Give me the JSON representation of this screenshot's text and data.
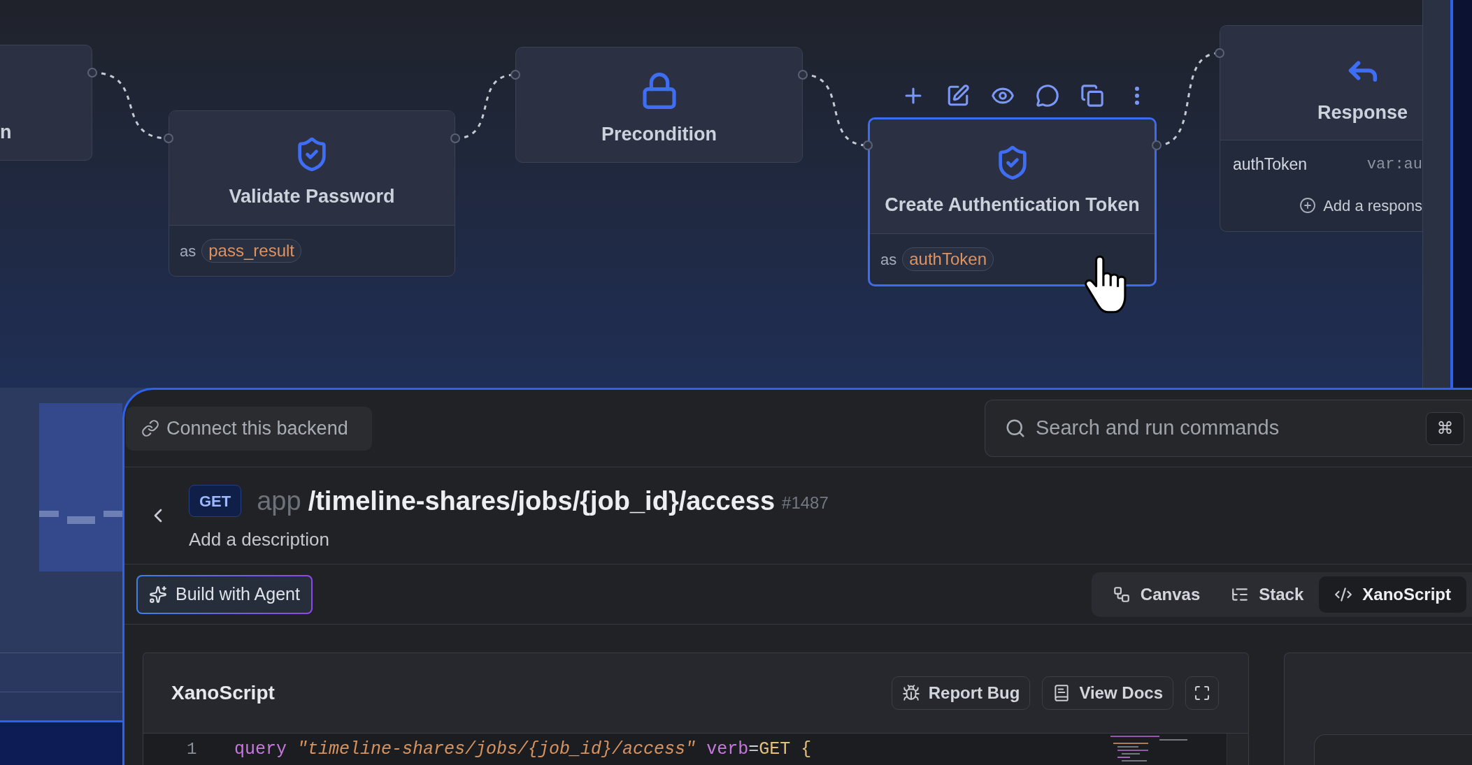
{
  "canvas": {
    "nodes": [
      {
        "kind": "partial",
        "title": "n",
        "selected": false
      },
      {
        "kind": "check",
        "title": "Validate Password",
        "as_label": "as",
        "variable": "pass_result",
        "selected": false
      },
      {
        "kind": "precondition",
        "title": "Precondition",
        "selected": false
      },
      {
        "kind": "check",
        "title": "Create Authentication Token",
        "as_label": "as",
        "variable": "authToken",
        "selected": true
      },
      {
        "kind": "response",
        "title": "Response",
        "fields": [
          {
            "name": "authToken",
            "value": "var:au"
          }
        ],
        "add_label": "Add a respons",
        "selected": false
      }
    ]
  },
  "top_bar": {
    "connect_button": "Connect this backend",
    "search": {
      "placeholder": "Search and run commands",
      "shortcut": "⌘"
    }
  },
  "endpoint": {
    "method": "GET",
    "app": "app",
    "path": "/timeline-shares/jobs/{job_id}/access",
    "number": "#1487",
    "description": "Add a description"
  },
  "toolbar": {
    "agent_button": "Build with Agent",
    "views": [
      {
        "kind": "canvas",
        "label": "Canvas",
        "selected": false
      },
      {
        "kind": "stack",
        "label": "Stack",
        "selected": false
      },
      {
        "kind": "script",
        "label": "XanoScript",
        "selected": true
      }
    ]
  },
  "editor": {
    "title": "XanoScript",
    "buttons": [
      {
        "kind": "bug",
        "label": "Report Bug"
      },
      {
        "kind": "docs",
        "label": "View Docs"
      }
    ],
    "lines": [
      {
        "number": "1",
        "words": [
          [
            {
              "kind": "keyword",
              "text": "query"
            }
          ],
          [
            {
              "kind": "string",
              "text": "\"timeline-shares/jobs/{job_id}/access\""
            }
          ],
          [
            {
              "kind": "attribute",
              "text": "verb"
            },
            {
              "kind": "operator",
              "text": "="
            },
            {
              "kind": "value",
              "text": "GET"
            }
          ],
          [
            {
              "kind": "brace",
              "text": "{"
            }
          ]
        ]
      }
    ]
  }
}
